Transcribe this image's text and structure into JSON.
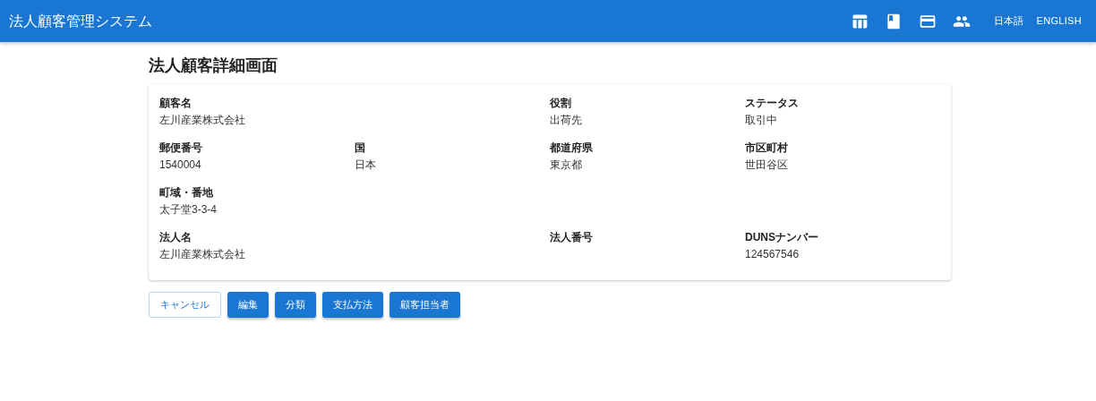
{
  "app_bar": {
    "title": "法人顧客管理システム",
    "languages": [
      "日本語",
      "ENGLISH"
    ]
  },
  "page_title": "法人顧客詳細画面",
  "rows": [
    [
      {
        "label": "顧客名",
        "value": "左川産業株式会社"
      },
      {
        "label": "役割",
        "value": "出荷先"
      },
      {
        "label": "ステータス",
        "value": "取引中"
      }
    ],
    [
      {
        "label": "郵便番号",
        "value": "1540004"
      },
      {
        "label": "国",
        "value": "日本"
      },
      {
        "label": "都道府県",
        "value": "東京都"
      },
      {
        "label": "市区町村",
        "value": "世田谷区"
      }
    ],
    [
      {
        "label": "町域・番地",
        "value": "太子堂3-3-4"
      }
    ],
    [
      {
        "label": "法人名",
        "value": "左川産業株式会社"
      },
      {
        "label": "法人番号"
      },
      {
        "label": "DUNSナンバー",
        "value": "124567546"
      }
    ]
  ],
  "buttons": [
    {
      "label": "キャンセル",
      "kind": "outlined"
    },
    {
      "label": "編集",
      "kind": "contained"
    },
    {
      "label": "分類",
      "kind": "contained"
    },
    {
      "label": "支払方法",
      "kind": "contained"
    },
    {
      "label": "顧客担当者",
      "kind": "contained"
    }
  ]
}
